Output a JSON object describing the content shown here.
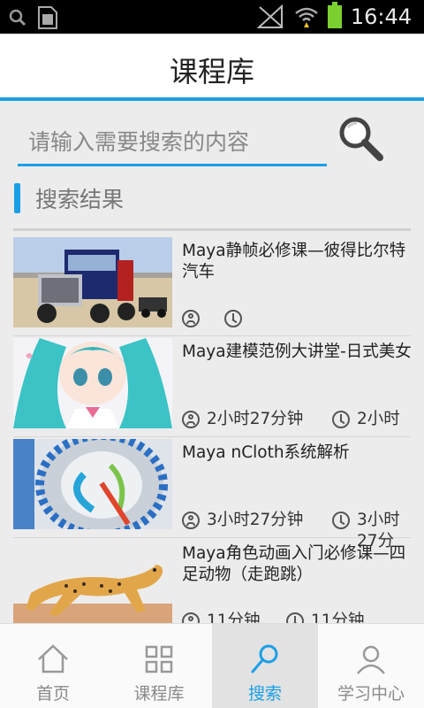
{
  "status_bar": {
    "time": "16:44"
  },
  "header": {
    "title": "课程库"
  },
  "search": {
    "placeholder": "请输入需要搜索的内容"
  },
  "section": {
    "title": "搜索结果"
  },
  "results": [
    {
      "title": "Maya静帧必修课—彼得比尔特汽车",
      "duration": "",
      "length": "",
      "image": "truck"
    },
    {
      "title": "Maya建模范例大讲堂-日式美女",
      "duration": "2小时27分钟",
      "length": "2小时",
      "image": "anime-girl"
    },
    {
      "title": "Maya nCloth系统解析",
      "duration": "3小时27分钟",
      "length": "3小时27分",
      "image": "cloth-tube"
    },
    {
      "title": "Maya角色动画入门必修课—四足动物（走跑跳）",
      "duration": "11分钟",
      "length": "11分钟",
      "image": "cheetah"
    }
  ],
  "nav": [
    {
      "label": "首页",
      "icon": "home-icon",
      "active": false
    },
    {
      "label": "课程库",
      "icon": "grid-icon",
      "active": false
    },
    {
      "label": "搜索",
      "icon": "search-icon",
      "active": true
    },
    {
      "label": "学习中心",
      "icon": "user-icon",
      "active": false
    }
  ],
  "colors": {
    "accent": "#1a9fe6",
    "battery": "#7bd02f"
  }
}
